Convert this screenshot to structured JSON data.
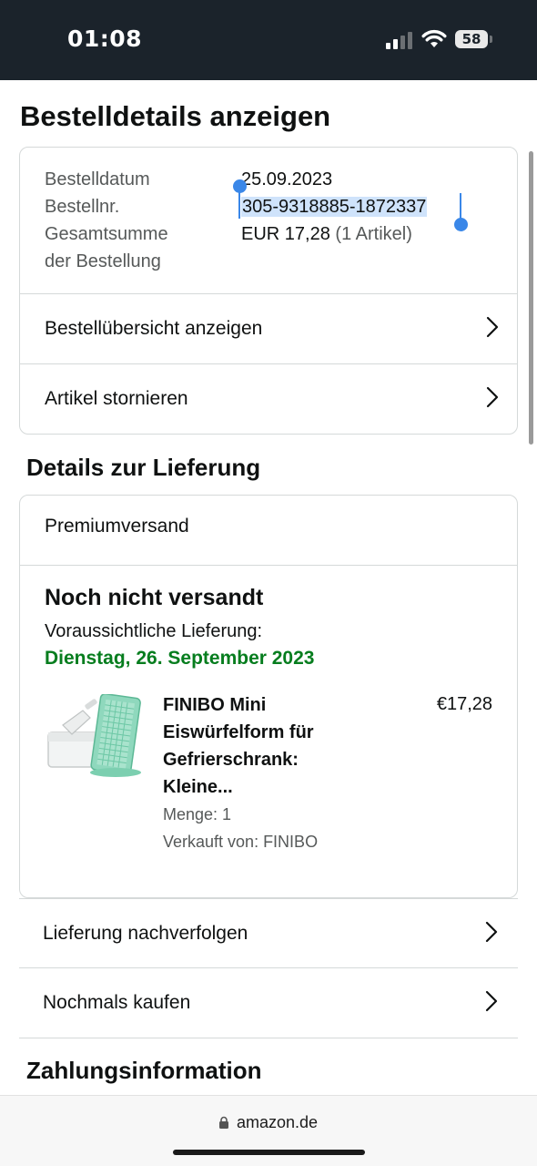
{
  "status_bar": {
    "time": "01:08",
    "battery": "58",
    "icons": [
      "signal-icon",
      "wifi-icon",
      "battery-icon"
    ]
  },
  "page_title": "Bestelldetails anzeigen",
  "order_summary": {
    "date_label": "Bestelldatum",
    "date_value": "25.09.2023",
    "number_label": "Bestellnr.",
    "number_value": "305-9318885-1872337",
    "total_label_line1": "Gesamtsumme",
    "total_label_line2": "der Bestellung",
    "total_value": "EUR 17,28",
    "total_items": "(1 Artikel)",
    "actions": [
      {
        "label": "Bestellübersicht anzeigen"
      },
      {
        "label": "Artikel stornieren"
      }
    ]
  },
  "delivery": {
    "heading": "Details zur Lieferung",
    "shipping_method": "Premiumversand",
    "status": "Noch nicht versandt",
    "expected_label": "Voraussichtliche Lieferung:",
    "expected_date": "Dienstag, 26. September 2023",
    "product": {
      "title_lines": [
        "FINIBO Mini",
        "Eiswürfelform für",
        "Gefrierschrank:",
        "Kleine..."
      ],
      "price": "€17,28",
      "quantity": "Menge: 1",
      "seller": "Verkauft von: FINIBO"
    },
    "actions": [
      {
        "label": "Lieferung nachverfolgen"
      },
      {
        "label": "Nochmals kaufen"
      }
    ]
  },
  "payment": {
    "heading": "Zahlungsinformation"
  },
  "browser": {
    "url": "amazon.de"
  },
  "colors": {
    "status_bar_bg": "#1b232b",
    "delivery_date_green": "#067d1e",
    "selection_blue": "#3a87e8",
    "border": "#d5d9d9"
  }
}
